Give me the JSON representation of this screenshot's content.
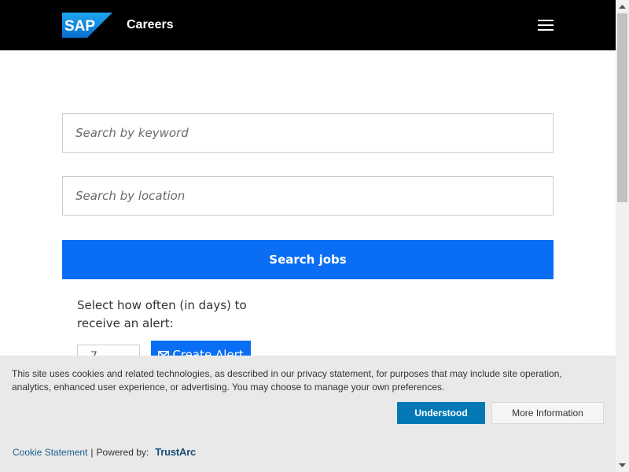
{
  "header": {
    "logo_text": "SAP",
    "title": "Careers",
    "menu_icon": "hamburger-menu-icon"
  },
  "search": {
    "keyword_placeholder": "Search by keyword",
    "location_placeholder": "Search by location",
    "button_label": "Search jobs"
  },
  "alert": {
    "label": "Select how often (in days) to receive an alert:",
    "days_value": "7",
    "create_label": "Create Alert",
    "create_icon": "envelope-icon"
  },
  "cookie": {
    "text": "This site uses cookies and related technologies, as described in our  privacy statement, for purposes that may include site operation, analytics, enhanced user experience, or advertising. You may choose to manage your own preferences.",
    "understood_label": "Understood",
    "more_label": "More Information",
    "statement_link": "Cookie Statement",
    "separator": "|",
    "powered_by": "Powered by:",
    "vendor": "TrustArc"
  },
  "colors": {
    "header_bg": "#000000",
    "sap_blue": "#0a6ef5",
    "cookie_bg": "#e9e9e9",
    "understood_bg": "#0478b5"
  }
}
